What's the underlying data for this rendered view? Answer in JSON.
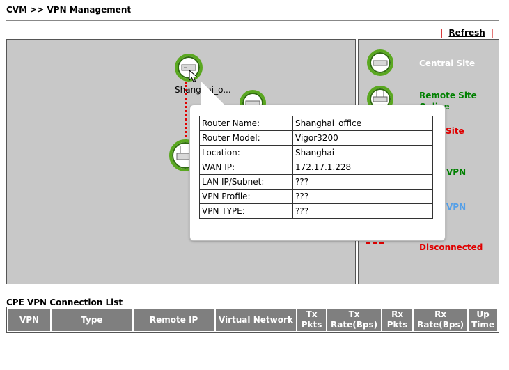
{
  "header": {
    "title": "CVM >> VPN Management",
    "refresh_label": "Refresh",
    "pipe": "|"
  },
  "map": {
    "node_label": "Shanghai_o..."
  },
  "tooltip": {
    "rows": [
      {
        "key": "Router Name:",
        "value": "Shanghai_office"
      },
      {
        "key": "Router Model:",
        "value": "Vigor3200"
      },
      {
        "key": "Location:",
        "value": "Shanghai"
      },
      {
        "key": "WAN IP:",
        "value": "172.17.1.228"
      },
      {
        "key": "LAN IP/Subnet:",
        "value": "???"
      },
      {
        "key": "VPN Profile:",
        "value": "???"
      },
      {
        "key": "VPN TYPE:",
        "value": "???"
      }
    ]
  },
  "legend": {
    "central": {
      "label": "Central Site",
      "color": "#ffffff"
    },
    "remote_online": {
      "label": "Remote Site Online",
      "color": "#008000"
    },
    "remote_offline": {
      "label": "te Site",
      "color": "#e00000"
    },
    "vpn_green": {
      "label": "VPN",
      "color": "#008000"
    },
    "vpn_blue": {
      "label": "VPN",
      "color": "#55a0e8"
    },
    "disconnected": {
      "label": "Disconnected",
      "color": "#e00000"
    }
  },
  "connection_list": {
    "title": "CPE VPN Connection List",
    "columns": [
      "VPN",
      "Type",
      "Remote IP",
      "Virtual Network",
      "Tx Pkts",
      "Tx Rate(Bps)",
      "Rx Pkts",
      "Rx Rate(Bps)",
      "Up Time"
    ]
  },
  "colors": {
    "accent_green": "#5aa820",
    "panel_gray": "#c8c8c8",
    "header_gray": "#7f7f7f",
    "dash_red": "#e00000"
  },
  "icons": [
    "router-icon",
    "pointer-cursor-icon"
  ]
}
